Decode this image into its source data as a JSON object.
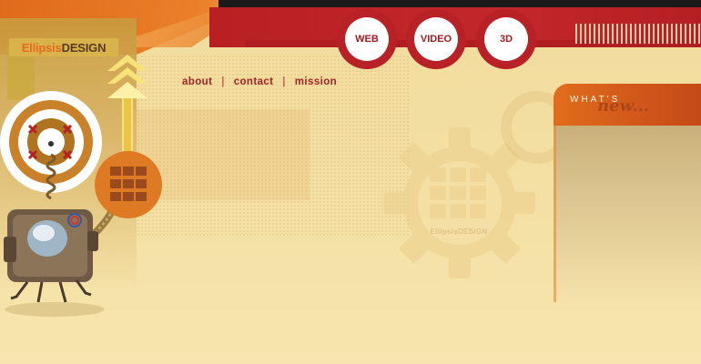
{
  "brand": {
    "part1": "Ellipsis",
    "part2": "DESIGN"
  },
  "nav_buttons": [
    {
      "label": "WEB"
    },
    {
      "label": "VIDEO"
    },
    {
      "label": "3D"
    }
  ],
  "links": [
    {
      "label": "about"
    },
    {
      "label": "contact"
    },
    {
      "label": "mission"
    }
  ],
  "link_separator": "|",
  "news": {
    "title": "WHAT'S",
    "subtitle": "new..."
  },
  "watermark": "EllipsisDESIGN",
  "colors": {
    "red": "#b82227",
    "orange": "#de7a24",
    "background": "#f3dfa0",
    "link": "#a3232a"
  },
  "icons": [
    "target-icon",
    "up-arrow-icon",
    "grid-logo-icon",
    "gear-icon",
    "robot-illustration"
  ]
}
